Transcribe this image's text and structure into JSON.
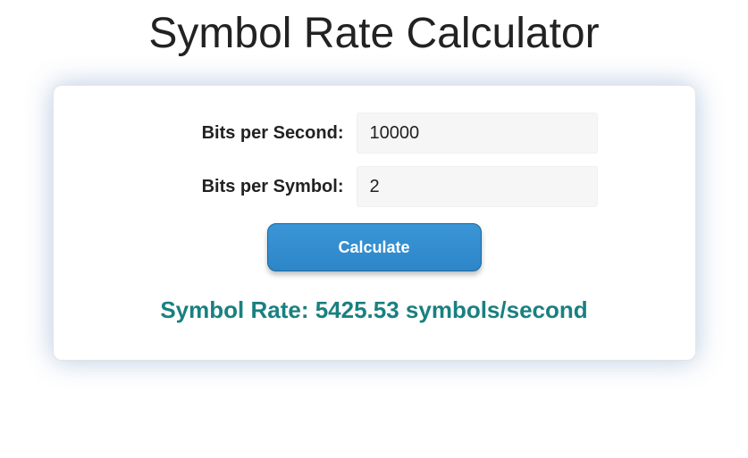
{
  "title": "Symbol Rate Calculator",
  "form": {
    "bits_per_second": {
      "label": "Bits per Second:",
      "value": "10000"
    },
    "bits_per_symbol": {
      "label": "Bits per Symbol:",
      "value": "2"
    },
    "calculate_label": "Calculate"
  },
  "result": {
    "prefix": "Symbol Rate: ",
    "value": "5425.53",
    "suffix": " symbols/second"
  }
}
